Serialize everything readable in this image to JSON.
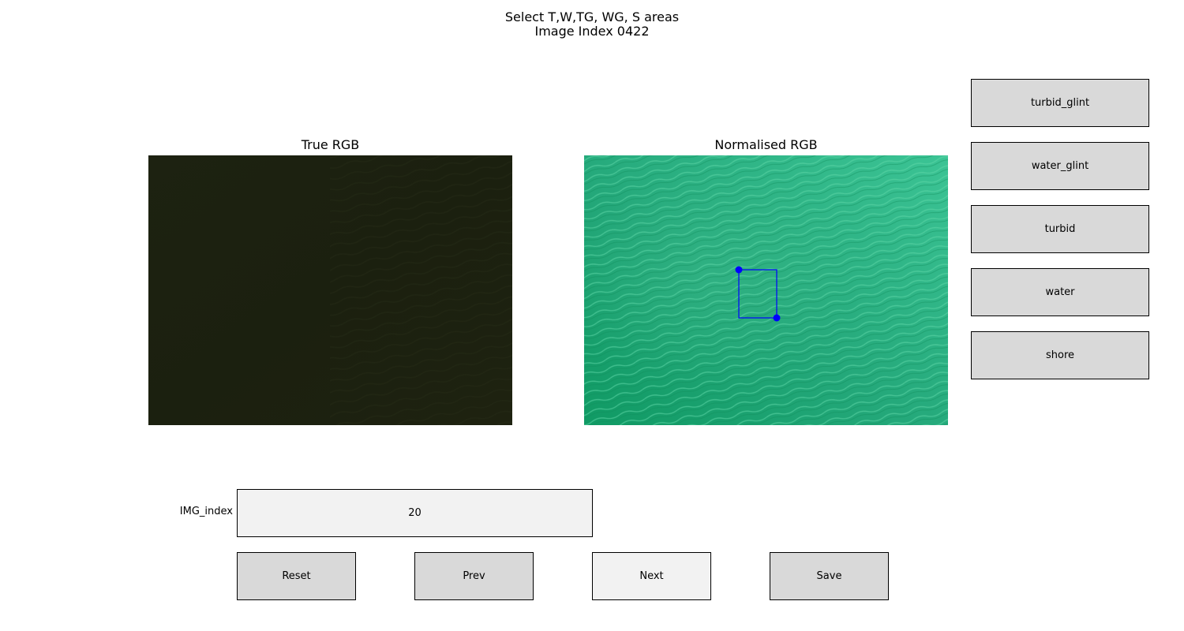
{
  "figure": {
    "title_line1": "Select T,W,TG, WG, S areas",
    "title_line2": "Image Index 0422"
  },
  "panels": {
    "true_rgb": {
      "title": "True RGB"
    },
    "normalised_rgb": {
      "title": "Normalised RGB"
    }
  },
  "class_buttons": [
    {
      "label": "turbid_glint"
    },
    {
      "label": "water_glint"
    },
    {
      "label": "turbid"
    },
    {
      "label": "water"
    },
    {
      "label": "shore"
    }
  ],
  "img_index": {
    "label": "IMG_index",
    "value": "20"
  },
  "nav_buttons": {
    "reset": "Reset",
    "prev": "Prev",
    "next": "Next",
    "save": "Save"
  },
  "colors": {
    "true_rgb_base": "#1c2010",
    "normalised_rgb_base": "#22a57a",
    "selection": "#0000ff",
    "button_face": "#d9d9d9",
    "button_hover": "#f2f2f2"
  }
}
